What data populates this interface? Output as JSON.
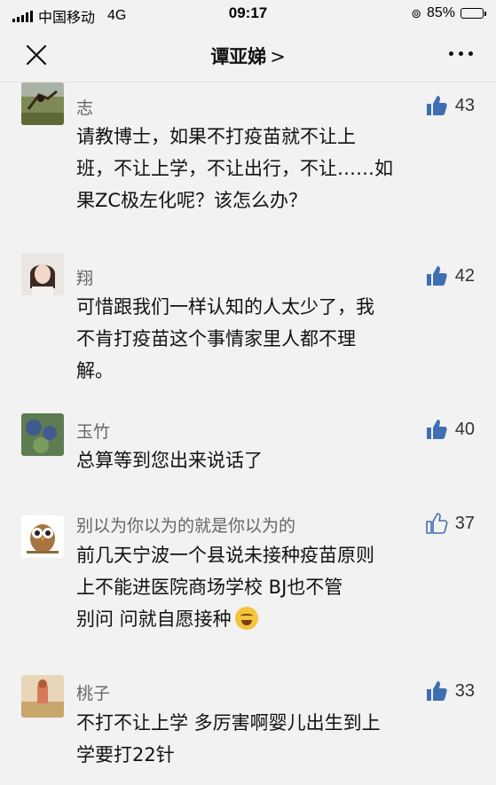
{
  "status_bar": {
    "carrier": "中国移动",
    "network": "4G",
    "time": "09:17",
    "battery": "85%",
    "battery_level": 0.85
  },
  "nav": {
    "title": "谭亚娣",
    "chevron": ">"
  },
  "comments": [
    {
      "name": "志",
      "likes": "43",
      "liked": true,
      "lines": [
        "请教博士，如果不打疫苗就不让上",
        "班，不让上学，不让出行，不让……如",
        "果ZC极左化呢？该怎么办？"
      ]
    },
    {
      "name": "翔",
      "likes": "42",
      "liked": true,
      "lines": [
        "可惜跟我们一样认知的人太少了，我",
        "不肯打疫苗这个事情家里人都不理",
        "解。"
      ]
    },
    {
      "name": "玉竹",
      "likes": "40",
      "liked": true,
      "lines": [
        "总算等到您出来说话了"
      ]
    },
    {
      "name": "别以为你以为的就是你以为的",
      "likes": "37",
      "liked": false,
      "lines": [
        "前几天宁波一个县说未接种疫苗原则",
        "上不能进医院商场学校 BJ也不管",
        "别问 问就自愿接种"
      ]
    },
    {
      "name": "桃子",
      "likes": "33",
      "liked": true,
      "lines": [
        "不打不让上学  多厉害啊婴儿出生到上",
        "学要打22针"
      ]
    }
  ]
}
